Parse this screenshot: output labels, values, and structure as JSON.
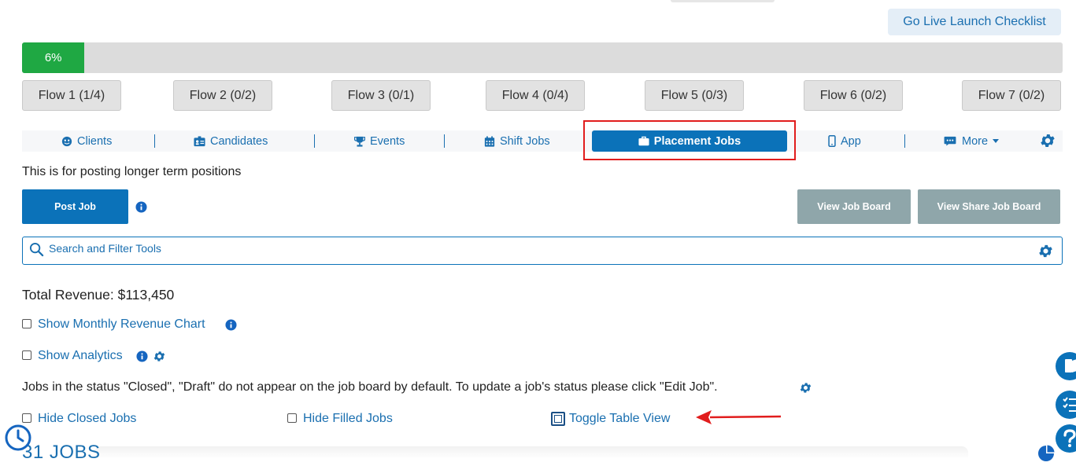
{
  "header": {
    "checklist_label": "Go Live Launch Checklist"
  },
  "progress": {
    "label": "6%",
    "value": 0.06
  },
  "flows": [
    {
      "label": "Flow 1 (1/4)"
    },
    {
      "label": "Flow 2 (0/2)"
    },
    {
      "label": "Flow 3 (0/1)"
    },
    {
      "label": "Flow 4 (0/4)"
    },
    {
      "label": "Flow 5 (0/3)"
    },
    {
      "label": "Flow 6 (0/2)"
    },
    {
      "label": "Flow 7 (0/2)"
    }
  ],
  "nav": {
    "clients": "Clients",
    "candidates": "Candidates",
    "events": "Events",
    "shift_jobs": "Shift Jobs",
    "placement_jobs": "Placement Jobs",
    "app": "App",
    "more": "More"
  },
  "intro": "This is for posting longer term positions",
  "actions": {
    "post_job": "Post Job",
    "view_job_board": "View Job Board",
    "view_share_job_board": "View Share Job Board"
  },
  "search": {
    "placeholder": "Search and Filter Tools"
  },
  "revenue": "Total Revenue: $113,450",
  "options": {
    "monthly_chart": "Show Monthly Revenue Chart",
    "analytics": "Show Analytics",
    "hide_closed": "Hide Closed Jobs",
    "hide_filled": "Hide Filled Jobs",
    "toggle_table": "Toggle Table View"
  },
  "status_note": "Jobs in the status \"Closed\", \"Draft\" do not appear on the job board by default. To update a job's status please click \"Edit Job\".",
  "jobs_title": "31 JOBS",
  "colors": {
    "accent": "#0b72b9",
    "progress": "#1fa843",
    "highlight": "#e11d1d"
  }
}
